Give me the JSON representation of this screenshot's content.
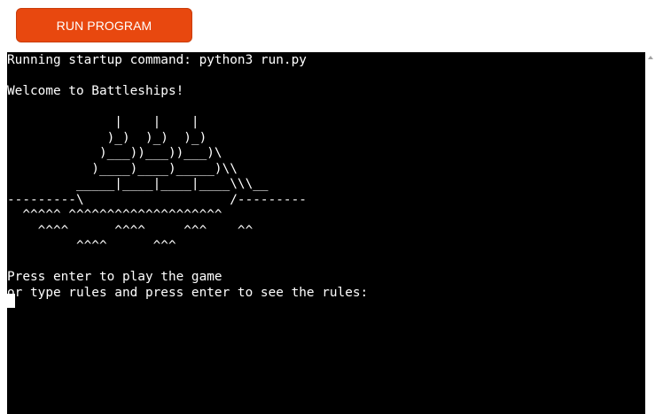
{
  "toolbar": {
    "run_label": "RUN PROGRAM"
  },
  "terminal": {
    "lines": [
      "Running startup command: python3 run.py",
      "",
      "Welcome to Battleships!",
      "",
      "              |    |    |",
      "             )_)  )_)  )_)",
      "            )___))___))___)\\",
      "           )____)____)_____)\\\\",
      "         _____|____|____|____\\\\\\__",
      "---------\\                   /---------",
      "  ^^^^^ ^^^^^^^^^^^^^^^^^^^^",
      "    ^^^^      ^^^^     ^^^    ^^",
      "         ^^^^      ^^^",
      "",
      "Press enter to play the game",
      "or type rules and press enter to see the rules:"
    ]
  },
  "colors": {
    "button_bg": "#e8480f",
    "terminal_bg": "#000000",
    "terminal_fg": "#ffffff"
  }
}
